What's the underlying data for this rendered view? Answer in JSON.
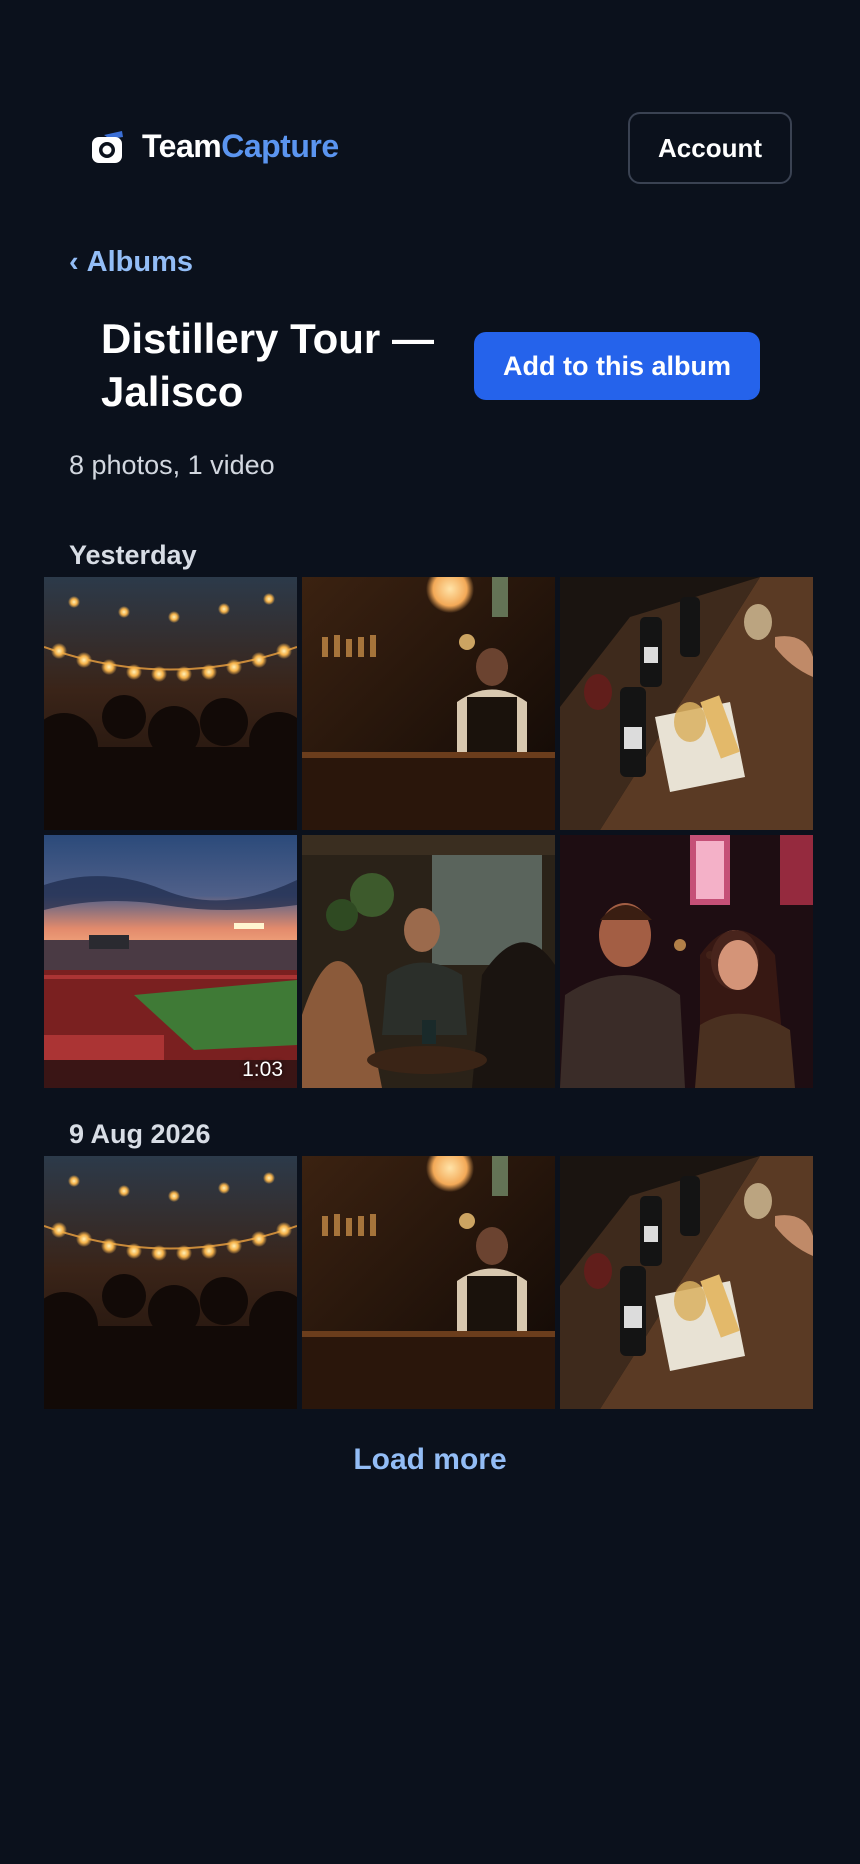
{
  "header": {
    "brand_part1": "Team",
    "brand_part2": "Capture",
    "logo_icon": "camera-icon",
    "account_label": "Account"
  },
  "nav": {
    "back_chevron": "‹",
    "back_label": "Albums"
  },
  "album": {
    "title": "Distillery Tour — Jalisco",
    "add_button_label": "Add to this album",
    "count_text": "8 photos, 1 video"
  },
  "sections": [
    {
      "title": "Yesterday",
      "items": [
        {
          "kind": "photo",
          "scene": "string-lights-crowd"
        },
        {
          "kind": "photo",
          "scene": "bartender-bar"
        },
        {
          "kind": "photo",
          "scene": "wine-table"
        },
        {
          "kind": "video",
          "scene": "stadium-crowd",
          "duration": "1:03"
        },
        {
          "kind": "photo",
          "scene": "friends-at-table"
        },
        {
          "kind": "photo",
          "scene": "laughing-couple"
        }
      ]
    },
    {
      "title": "9 Aug 2026",
      "items": [
        {
          "kind": "photo",
          "scene": "string-lights-crowd"
        },
        {
          "kind": "photo",
          "scene": "bartender-bar"
        },
        {
          "kind": "photo",
          "scene": "wine-table"
        }
      ]
    }
  ],
  "load_more_label": "Load more",
  "colors": {
    "background": "#0b111c",
    "accent": "#2563eb",
    "link": "#93bdf6",
    "brand_blue": "#5b95f0"
  }
}
